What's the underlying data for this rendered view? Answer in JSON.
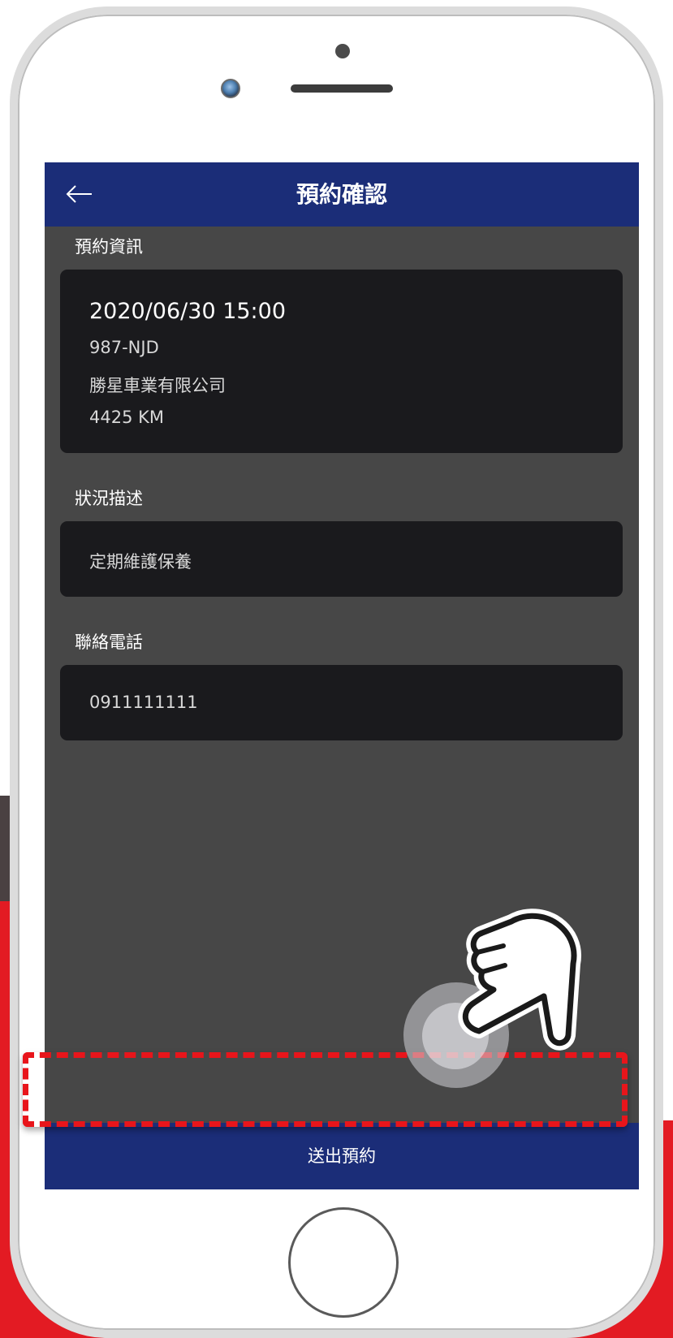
{
  "app": {
    "title": "預約確認",
    "back_icon": "arrow-left-icon"
  },
  "booking": {
    "section_label": "預約資訊",
    "datetime": "2020/06/30 15:00",
    "plate": "987-NJD",
    "company": "勝星車業有限公司",
    "mileage": "4425 KM"
  },
  "description": {
    "section_label": "狀況描述",
    "value": "定期維護保養"
  },
  "contact": {
    "section_label": "聯絡電話",
    "value": "0911111111"
  },
  "actions": {
    "submit_label": "送出預約"
  },
  "colors": {
    "appbar": "#1b2d78",
    "screen_bg": "#474747",
    "card_bg": "#1a1a1d",
    "highlight": "#e8151b",
    "backdrop_red": "#e31b23"
  },
  "overlay": {
    "tap_icon": "pointing-hand-icon"
  }
}
